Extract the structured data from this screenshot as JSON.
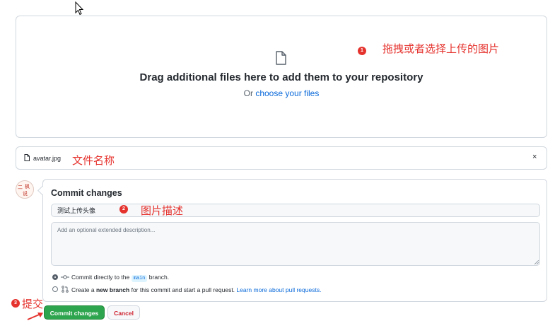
{
  "upload": {
    "title": "Drag additional files here to add them to your repository",
    "or_text": "Or",
    "choose_link": "choose your files"
  },
  "file": {
    "name": "avatar.jpg",
    "remove_symbol": "×"
  },
  "commit": {
    "title": "Commit changes",
    "summary_value": "测试上传头像",
    "description_placeholder": "Add an optional extended description...",
    "option_direct": {
      "prefix": "Commit directly to the",
      "branch": "main",
      "suffix": "branch."
    },
    "option_new": {
      "prefix": "Create a",
      "bold": "new branch",
      "middle": "for this commit and start a pull request.",
      "link": "Learn more about pull requests."
    },
    "selected_option": "direct"
  },
  "buttons": {
    "commit": "Commit changes",
    "cancel": "Cancel"
  },
  "annotations": [
    {
      "num": "1",
      "text": "拖拽或者选择上传的图片"
    },
    {
      "num": "2",
      "text": "图片描述"
    },
    {
      "num": "3",
      "text": "提交"
    }
  ],
  "annotation_file_label": "文件名称",
  "avatar_glyphs": [
    "二",
    "枫",
    "说"
  ],
  "colors": {
    "annotation": "#e5322d",
    "primary_button": "#2da44e",
    "link": "#0969da",
    "danger": "#cf222e"
  }
}
